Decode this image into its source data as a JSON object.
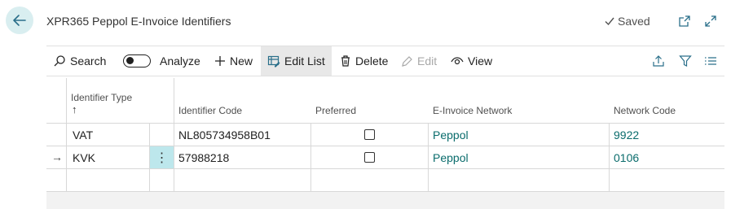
{
  "header": {
    "title": "XPR365 Peppol E-Invoice Identifiers",
    "saved_label": "Saved",
    "icons": [
      "arrow-left-icon",
      "checkmark-icon",
      "open-new-window-icon",
      "expand-icon"
    ]
  },
  "toolbar": {
    "search_label": "Search",
    "analyze_label": "Analyze",
    "new_label": "New",
    "edit_list_label": "Edit List",
    "delete_label": "Delete",
    "edit_label": "Edit",
    "view_label": "View",
    "icons": [
      "search-icon",
      "toggle-switch",
      "plus-icon",
      "edit-list-icon",
      "trash-icon",
      "pencil-icon",
      "eye-icon",
      "share-icon",
      "filter-icon",
      "list-icon"
    ]
  },
  "table": {
    "columns": {
      "identifier_type": "Identifier Type",
      "sort_arrow": "↑",
      "identifier_code": "Identifier Code",
      "preferred": "Preferred",
      "network": "E-Invoice Network",
      "network_code": "Network Code"
    },
    "rows": [
      {
        "marker": "",
        "type": "VAT",
        "code": "NL805734958B01",
        "preferred": false,
        "network": "Peppol",
        "network_code": "9922"
      },
      {
        "marker": "→",
        "type": "KVK",
        "code": "57988218",
        "preferred": false,
        "network": "Peppol",
        "network_code": "0106",
        "menu": "⋮"
      }
    ]
  },
  "colors": {
    "accent": "#0a6c6c",
    "back_button_bg": "#d9eef0",
    "selected_menu_bg": "#bde7ec"
  }
}
